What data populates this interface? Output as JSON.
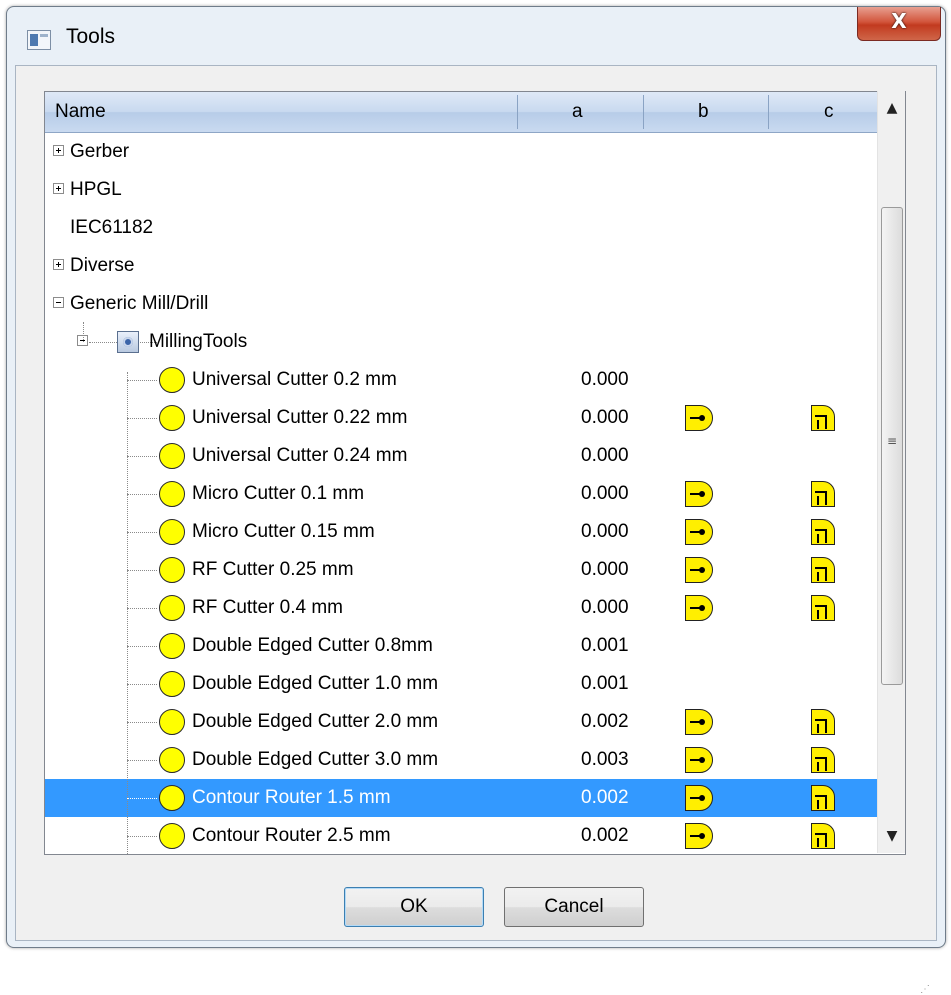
{
  "window": {
    "title": "Tools",
    "close_label": "X"
  },
  "columns": {
    "name": "Name",
    "a": "a",
    "b": "b",
    "c": "c"
  },
  "tree": {
    "gerber": "Gerber",
    "hpgl": "HPGL",
    "iec": "IEC61182",
    "diverse": "Diverse",
    "generic": "Generic Mill/Drill",
    "milling_tools": "MillingTools"
  },
  "tools": [
    {
      "name": "Universal Cutter 0.2 mm",
      "a": "0.000",
      "b": false,
      "c": false
    },
    {
      "name": "Universal Cutter 0.22 mm",
      "a": "0.000",
      "b": true,
      "c": true
    },
    {
      "name": "Universal Cutter 0.24 mm",
      "a": "0.000",
      "b": false,
      "c": false
    },
    {
      "name": "Micro Cutter 0.1 mm",
      "a": "0.000",
      "b": true,
      "c": true
    },
    {
      "name": "Micro Cutter 0.15 mm",
      "a": "0.000",
      "b": true,
      "c": true
    },
    {
      "name": "RF Cutter 0.25 mm",
      "a": "0.000",
      "b": true,
      "c": true
    },
    {
      "name": "RF Cutter 0.4 mm",
      "a": "0.000",
      "b": true,
      "c": true
    },
    {
      "name": "Double Edged Cutter 0.8mm",
      "a": "0.001",
      "b": false,
      "c": false
    },
    {
      "name": "Double Edged Cutter 1.0 mm",
      "a": "0.001",
      "b": false,
      "c": false
    },
    {
      "name": "Double Edged Cutter 2.0 mm",
      "a": "0.002",
      "b": true,
      "c": true
    },
    {
      "name": "Double Edged Cutter 3.0 mm",
      "a": "0.003",
      "b": true,
      "c": true
    },
    {
      "name": "Contour Router 1.5 mm",
      "a": "0.002",
      "b": true,
      "c": true,
      "selected": true
    },
    {
      "name": "Contour Router 2.5 mm",
      "a": "0.002",
      "b": true,
      "c": true
    }
  ],
  "buttons": {
    "ok": "OK",
    "cancel": "Cancel"
  },
  "icons": {
    "tool": "tool-circle-icon",
    "b": "tool-profile-b-icon",
    "c": "tool-profile-c-icon"
  },
  "colors": {
    "selection": "#3399ff",
    "tool_fill": "#ffff00"
  }
}
